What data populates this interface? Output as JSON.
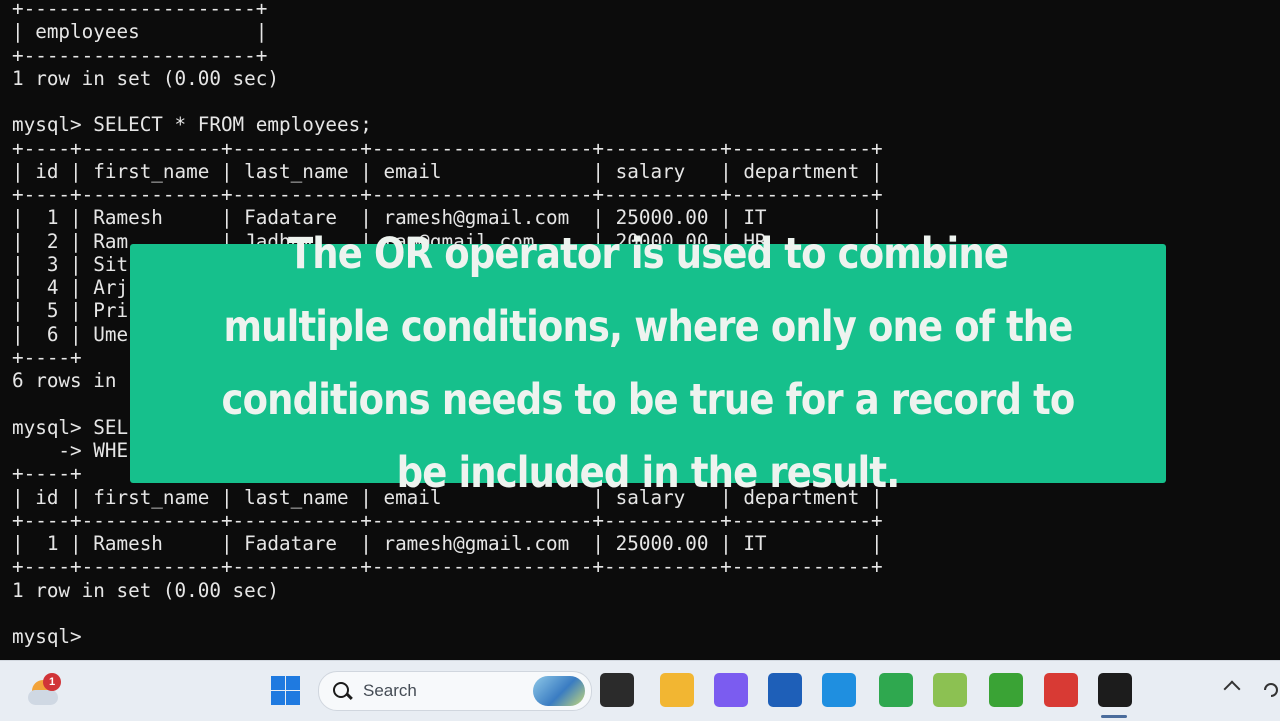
{
  "terminal": {
    "lines": [
      "+--------------------+",
      "| employees          |",
      "+--------------------+",
      "1 row in set (0.00 sec)",
      "",
      "mysql> SELECT * FROM employees;",
      "+----+------------+-----------+-------------------+----------+------------+",
      "| id | first_name | last_name | email             | salary   | department |",
      "+----+------------+-----------+-------------------+----------+------------+",
      "|  1 | Ramesh     | Fadatare  | ramesh@gmail.com  | 25000.00 | IT         |",
      "|  2 | Ram        | Jadhav    | ram@gmail.com     | 20000.00 | HR         |",
      "|  3 | Sit",
      "|  4 | Arj",
      "|  5 | Pri",
      "|  6 | Ume",
      "+----+",
      "6 rows in s",
      "",
      "mysql> SEL",
      "    -> WHE",
      "+----+",
      "| id | first_name | last_name | email             | salary   | department |",
      "+----+------------+-----------+-------------------+----------+------------+",
      "|  1 | Ramesh     | Fadatare  | ramesh@gmail.com  | 25000.00 | IT         |",
      "+----+------------+-----------+-------------------+----------+------------+",
      "1 row in set (0.00 sec)",
      "",
      "mysql>"
    ]
  },
  "overlay": {
    "text": "The OR operator is used to combine multiple conditions, where only one of the conditions needs to be true for a record to be included in the result."
  },
  "taskbar": {
    "weather_badge": "1",
    "search_placeholder": "Search",
    "apps": [
      {
        "name": "task-view-icon",
        "color": "#2b2b2b"
      },
      {
        "name": "file-explorer-icon",
        "color": "#f2b632"
      },
      {
        "name": "copilot-icon",
        "color": "#7b5cf0"
      },
      {
        "name": "microsoft-store-icon",
        "color": "#1e5fb8"
      },
      {
        "name": "edge-icon",
        "color": "#1f8fe0"
      },
      {
        "name": "chrome-icon",
        "color": "#2fa84f"
      },
      {
        "name": "notepad-plus-plus-icon",
        "color": "#8cc152"
      },
      {
        "name": "camtasia-green-icon",
        "color": "#3aa335"
      },
      {
        "name": "camtasia-red-icon",
        "color": "#d83a34"
      },
      {
        "name": "terminal-icon",
        "color": "#1c1c1c"
      }
    ]
  }
}
